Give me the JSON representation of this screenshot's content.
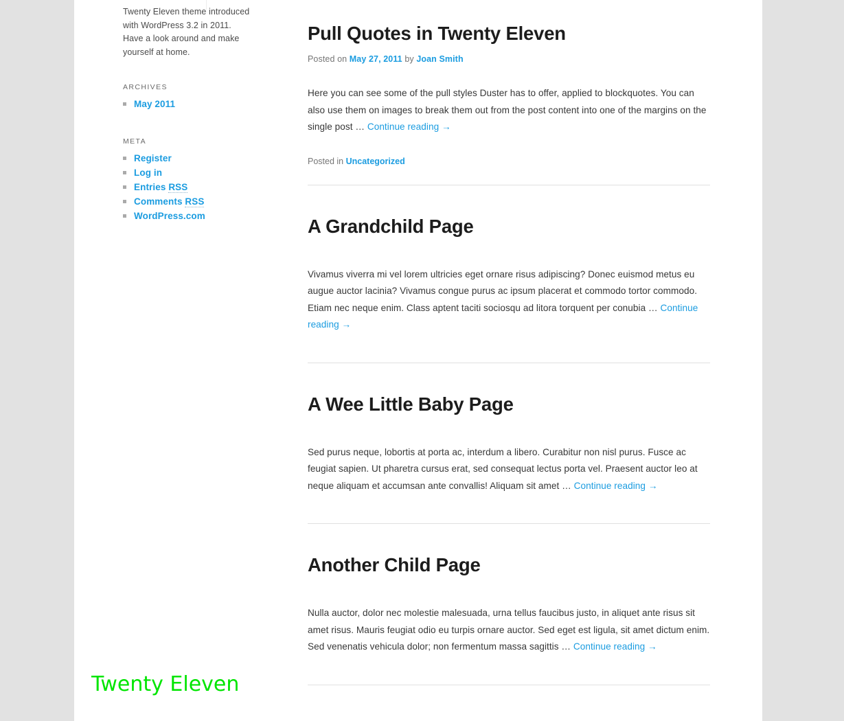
{
  "site": {
    "background_color": "#e2e2e2",
    "content_background": "#ffffff",
    "link_color": "#1b9ce0",
    "text_color": "#373737",
    "heading_color": "#1c1c1c",
    "meta_color": "#757575"
  },
  "sidebar": {
    "description": "Twenty Eleven theme introduced with WordPress 3.2 in 2011. Have a look around and make yourself at home.",
    "widgets": [
      {
        "title": "ARCHIVES",
        "items": [
          {
            "label": "May 2011",
            "abbr": ""
          }
        ]
      },
      {
        "title": "META",
        "items": [
          {
            "label": "Register",
            "abbr": ""
          },
          {
            "label": "Log in",
            "abbr": ""
          },
          {
            "label": "Entries ",
            "abbr": "RSS"
          },
          {
            "label": "Comments ",
            "abbr": "RSS"
          },
          {
            "label": "WordPress.com",
            "abbr": ""
          }
        ]
      }
    ]
  },
  "posts": [
    {
      "title": "Pull Quotes in Twenty Eleven",
      "meta": {
        "posted_on_label": "Posted on",
        "date": "May 27, 2011",
        "by_label": "by",
        "author": "Joan Smith"
      },
      "summary": "Here you can see some of the pull styles Duster has to offer, applied to blockquotes. You can also use them on images to break them out from the post content into one of the margins on the single post … ",
      "more_label": "Continue reading →",
      "footer": {
        "posted_in_label": "Posted in",
        "category": "Uncategorized"
      }
    },
    {
      "title": "A Grandchild Page",
      "summary": "Vivamus viverra mi vel lorem ultricies eget ornare risus adipiscing? Donec euismod metus eu augue auctor lacinia? Vivamus congue purus ac ipsum placerat et commodo tortor commodo. Etiam nec neque enim. Class aptent taciti sociosqu ad litora torquent per conubia … ",
      "more_label": "Continue reading →"
    },
    {
      "title": "A Wee Little Baby Page",
      "summary": "Sed purus neque, lobortis at porta ac, interdum a libero. Curabitur non nisl purus. Fusce ac feugiat sapien. Ut pharetra cursus erat, sed consequat lectus porta vel. Praesent auctor leo at neque aliquam et accumsan ante convallis! Aliquam sit amet … ",
      "more_label": "Continue reading →"
    },
    {
      "title": "Another Child Page",
      "summary": "Nulla auctor, dolor nec molestie malesuada, urna tellus faucibus justo, in aliquet ante risus sit amet risus. Mauris feugiat odio eu turpis ornare auctor. Sed eget est ligula, sit amet dictum enim. Sed venenatis vehicula dolor; non fermentum massa sagittis … ",
      "more_label": "Continue reading →"
    }
  ],
  "overlay": {
    "label": "Twenty Eleven",
    "color": "#00e500"
  }
}
